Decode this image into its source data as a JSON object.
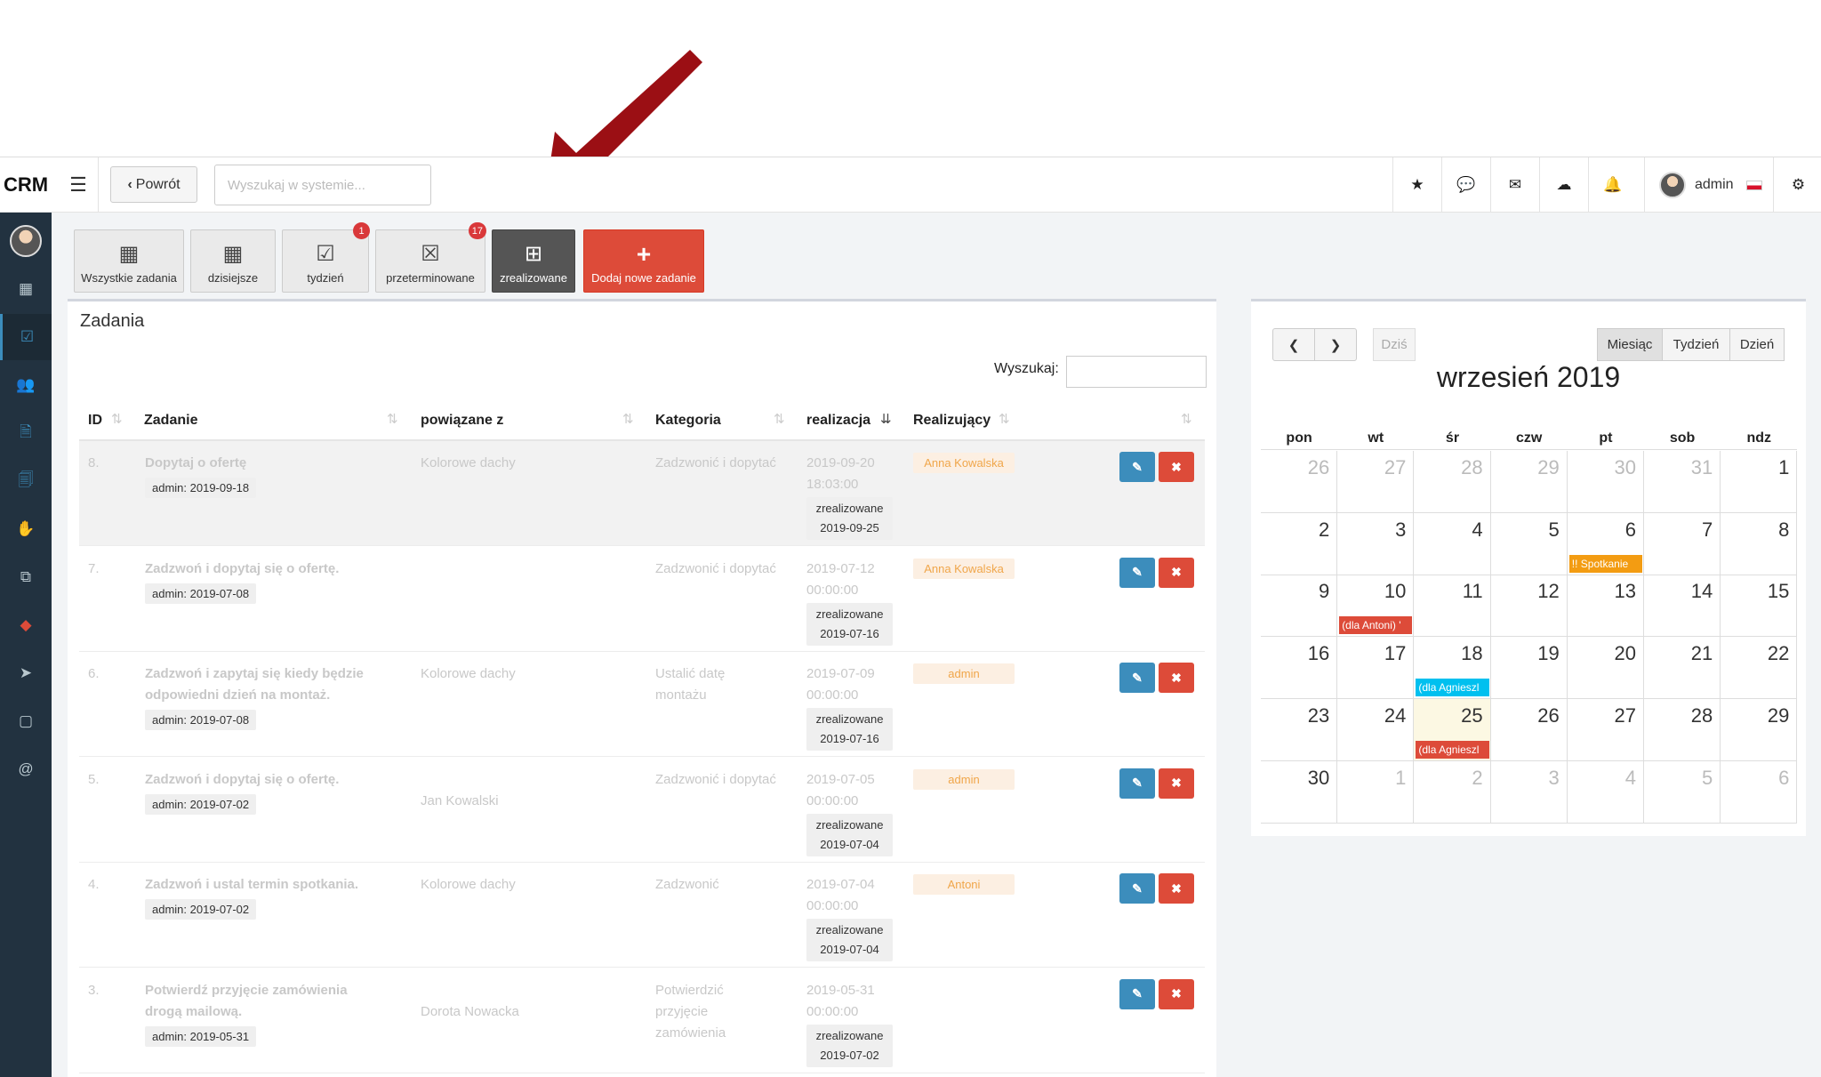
{
  "header": {
    "brand": "CRM",
    "back_label": "Powrót",
    "search_placeholder": "Wyszukaj w systemie...",
    "user_name": "admin"
  },
  "tabs": [
    {
      "label": "Wszystkie zadania",
      "icon": "calendar-icon",
      "badge": ""
    },
    {
      "label": "dzisiejsze",
      "icon": "calendar-icon",
      "badge": ""
    },
    {
      "label": "tydzień",
      "icon": "calendar-check-icon",
      "badge": "1"
    },
    {
      "label": "przeterminowane",
      "icon": "calendar-x-icon",
      "badge": "17"
    },
    {
      "label": "zrealizowane",
      "icon": "calendar-plus-icon",
      "badge": ""
    },
    {
      "label": "Dodaj nowe zadanie",
      "icon": "plus-icon",
      "badge": ""
    }
  ],
  "panel": {
    "title": "Zadania",
    "search_label": "Wyszukaj:",
    "columns": [
      "ID",
      "Zadanie",
      "powiązane z",
      "Kategoria",
      "realizacja",
      "Realizujący"
    ]
  },
  "rows": [
    {
      "id": "8.",
      "task": [
        "Dopytaj o ofertę"
      ],
      "meta": "admin: 2019-09-18",
      "related": "Kolorowe dachy",
      "category": [
        "Zadzwonić i dopytać"
      ],
      "date": [
        "2019-09-20",
        "18:03:00"
      ],
      "status": "zrealizowane",
      "status_date": "2019-09-25",
      "assignee": "Anna Kowalska"
    },
    {
      "id": "7.",
      "task": [
        "Zadzwoń i dopytaj się o ofertę."
      ],
      "meta": "admin: 2019-07-08",
      "related": "",
      "category": [
        "Zadzwonić i dopytać"
      ],
      "date": [
        "2019-07-12",
        "00:00:00"
      ],
      "status": "zrealizowane",
      "status_date": "2019-07-16",
      "assignee": "Anna Kowalska"
    },
    {
      "id": "6.",
      "task": [
        "Zadzwoń i zapytaj się kiedy będzie",
        "odpowiedni dzień na montaż."
      ],
      "meta": "admin: 2019-07-08",
      "related": "Kolorowe dachy",
      "category": [
        "Ustalić datę",
        "montażu"
      ],
      "date": [
        "2019-07-09",
        "00:00:00"
      ],
      "status": "zrealizowane",
      "status_date": "2019-07-16",
      "assignee": "admin"
    },
    {
      "id": "5.",
      "task": [
        "Zadzwoń i dopytaj się o ofertę."
      ],
      "meta": "admin: 2019-07-02",
      "related": "Jan Kowalski",
      "category": [
        "Zadzwonić i dopytać"
      ],
      "date": [
        "2019-07-05",
        "00:00:00"
      ],
      "status": "zrealizowane",
      "status_date": "2019-07-04",
      "assignee": "admin"
    },
    {
      "id": "4.",
      "task": [
        "Zadzwoń i ustal termin spotkania."
      ],
      "meta": "admin: 2019-07-02",
      "related": "Kolorowe dachy",
      "category": [
        "Zadzwonić"
      ],
      "date": [
        "2019-07-04",
        "00:00:00"
      ],
      "status": "zrealizowane",
      "status_date": "2019-07-04",
      "assignee": "Antoni"
    },
    {
      "id": "3.",
      "task": [
        "Potwierdź przyjęcie zamówienia",
        "drogą mailową."
      ],
      "meta": "admin: 2019-05-31",
      "related": "Dorota Nowacka",
      "category": [
        "Potwierdzić",
        "przyjęcie",
        "zamówienia"
      ],
      "date": [
        "2019-05-31",
        "00:00:00"
      ],
      "status": "zrealizowane",
      "status_date": "2019-07-02",
      "assignee": ""
    }
  ],
  "calendar": {
    "title": "wrzesień 2019",
    "today_label": "Dziś",
    "views": [
      "Miesiąc",
      "Tydzień",
      "Dzień"
    ],
    "active_view": "Miesiąc",
    "weekdays": [
      "pon",
      "wt",
      "śr",
      "czw",
      "pt",
      "sob",
      "ndz"
    ],
    "weeks": [
      [
        "26",
        "27",
        "28",
        "29",
        "30",
        "31",
        "1"
      ],
      [
        "2",
        "3",
        "4",
        "5",
        "6",
        "7",
        "8"
      ],
      [
        "9",
        "10",
        "11",
        "12",
        "13",
        "14",
        "15"
      ],
      [
        "16",
        "17",
        "18",
        "19",
        "20",
        "21",
        "22"
      ],
      [
        "23",
        "24",
        "25",
        "26",
        "27",
        "28",
        "29"
      ],
      [
        "30",
        "1",
        "2",
        "3",
        "4",
        "5",
        "6"
      ]
    ],
    "today": "25",
    "events": [
      {
        "week": 1,
        "day": 4,
        "text": "!! Spotkanie",
        "color": "#f39c12"
      },
      {
        "week": 2,
        "day": 1,
        "text": "(dla Antoni) '",
        "color": "#dd4b39"
      },
      {
        "week": 3,
        "day": 2,
        "text": "(dla Agnieszl",
        "color": "#00c0ef"
      },
      {
        "week": 4,
        "day": 2,
        "text": "(dla Agnieszl",
        "color": "#dd4b39"
      }
    ]
  },
  "colors": {
    "accent_red": "#dd4b39",
    "sidebar": "#223240",
    "arrow": "#9b0f14"
  }
}
